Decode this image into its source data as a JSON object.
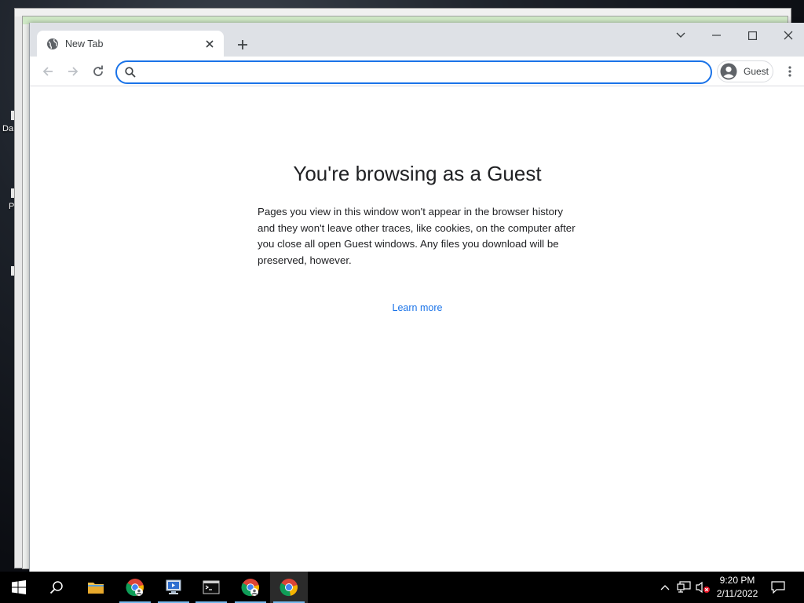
{
  "desktop": {
    "icons": [
      {
        "label": "Da"
      },
      {
        "label": "P"
      }
    ]
  },
  "browser": {
    "tab": {
      "title": "New Tab"
    },
    "omnibox": {
      "value": "",
      "placeholder": ""
    },
    "profile": {
      "label": "Guest"
    }
  },
  "page": {
    "title": "You're browsing as a Guest",
    "description": "Pages you view in this window won't appear in the browser history and they won't leave other traces, like cookies, on the computer after you close all open Guest windows. Any files you download will be preserved, however.",
    "learn_more": "Learn more"
  },
  "taskbar": {
    "items": [
      "start-icon",
      "search-icon",
      "file-explorer-icon",
      "chrome-profile-icon",
      "remote-desktop-icon",
      "terminal-icon",
      "chrome-profile-icon",
      "chrome-icon"
    ],
    "clock": {
      "time": "9:20 PM",
      "date": "2/11/2022"
    }
  },
  "colors": {
    "accent": "#1a73e8",
    "tabstrip": "#dee1e6",
    "taskbar": "#000000"
  }
}
